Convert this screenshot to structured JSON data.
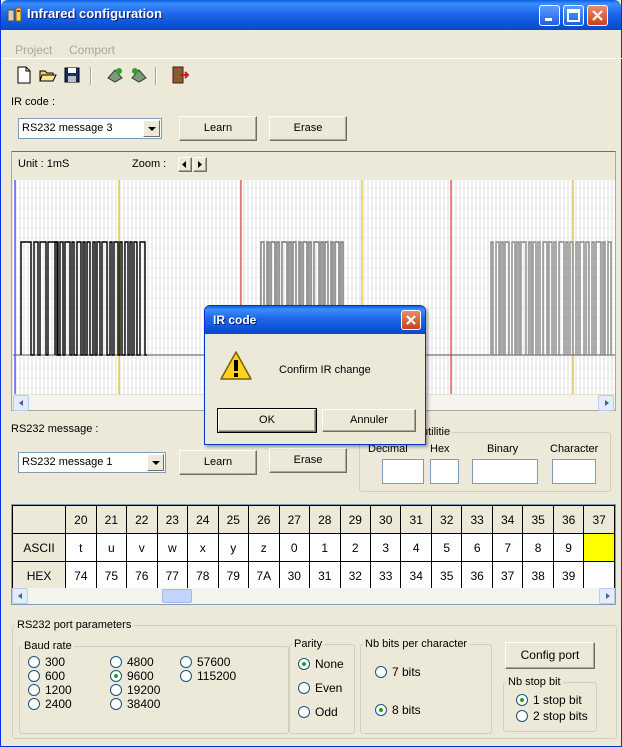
{
  "window": {
    "title": "Infrared configuration"
  },
  "menu": [
    "Project",
    "Comport"
  ],
  "toolbar": {
    "icons": [
      "new-file-icon",
      "open-folder-icon",
      "save-disk-icon",
      "send-icon",
      "receive-icon",
      "exit-door-icon"
    ]
  },
  "ir": {
    "label": "IR code :",
    "combo_value": "RS232 message 3",
    "learn": "Learn",
    "erase": "Erase",
    "unit": "Unit : 1mS",
    "zoom": "Zoom :"
  },
  "dialog": {
    "title": "IR code",
    "message": "Confirm IR change",
    "ok": "OK",
    "cancel": "Annuler"
  },
  "rs232": {
    "label": "RS232 message :",
    "combo_value": "RS232 message 1",
    "learn": "Learn",
    "erase": "Erase",
    "conv_title": "utilitie",
    "conv_decimal": "Decimal",
    "conv_hex": "Hex",
    "conv_binary": "Binary",
    "conv_character": "Character"
  },
  "grid": {
    "header": [
      "20",
      "21",
      "22",
      "23",
      "24",
      "25",
      "26",
      "27",
      "28",
      "29",
      "30",
      "31",
      "32",
      "33",
      "34",
      "35",
      "36",
      "37"
    ],
    "rows": [
      {
        "label": "ASCII",
        "cells": [
          "t",
          "u",
          "v",
          "w",
          "x",
          "y",
          "z",
          "0",
          "1",
          "2",
          "3",
          "4",
          "5",
          "6",
          "7",
          "8",
          "9",
          ""
        ]
      },
      {
        "label": "HEX",
        "cells": [
          "74",
          "75",
          "76",
          "77",
          "78",
          "79",
          "7A",
          "30",
          "31",
          "32",
          "33",
          "34",
          "35",
          "36",
          "37",
          "38",
          "39",
          ""
        ]
      }
    ],
    "selected_color": "#ffff00"
  },
  "port": {
    "title": "RS232 port parameters",
    "baud_title": "Baud rate",
    "bauds": [
      "300",
      "4800",
      "57600",
      "600",
      "9600",
      "115200",
      "1200",
      "19200",
      "2400",
      "38400"
    ],
    "baud_selected": "9600",
    "parity_title": "Parity",
    "parity": [
      "None",
      "Even",
      "Odd"
    ],
    "parity_selected": "None",
    "bits_title": "Nb bits per character",
    "bits": [
      "7 bits",
      "8 bits"
    ],
    "bits_selected": "8 bits",
    "config": "Config port",
    "stop_title": "Nb stop bit",
    "stop": [
      "1 stop bit",
      "2 stop bits"
    ],
    "stop_selected": "1 stop bit"
  }
}
